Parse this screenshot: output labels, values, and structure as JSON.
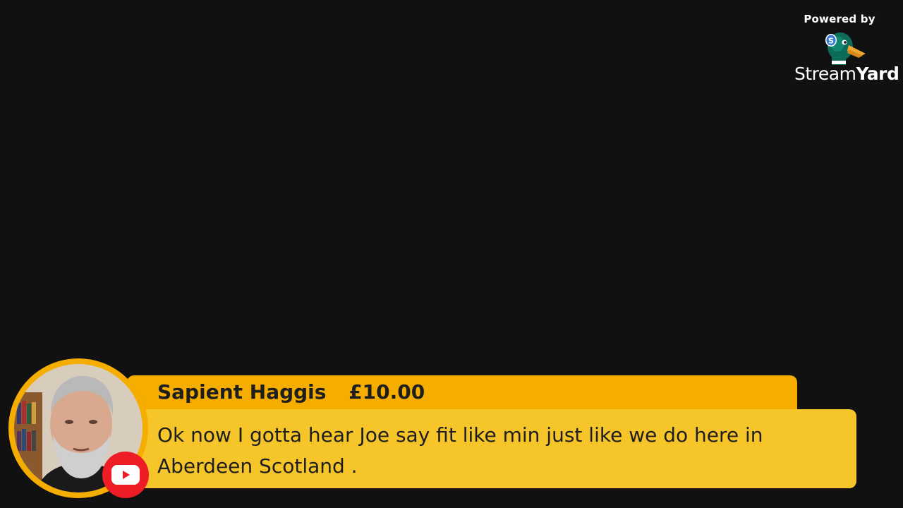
{
  "branding": {
    "powered_by": "Powered by",
    "brand_light": "Stream",
    "brand_bold": "Yard",
    "logo_icon": "streamyard-duck-icon"
  },
  "comment": {
    "author": "Sapient Haggis",
    "amount": "£10.00",
    "message": "Ok now I gotta hear Joe say fit like min just like we do here in Aberdeen Scotland .",
    "platform_icon": "youtube-icon",
    "avatar": "user-avatar"
  },
  "colors": {
    "background": "#111111",
    "name_bar": "#f5ad00",
    "message_bar": "#f5c52a",
    "youtube_red": "#ee1c24",
    "text": "#1e1e1e"
  }
}
